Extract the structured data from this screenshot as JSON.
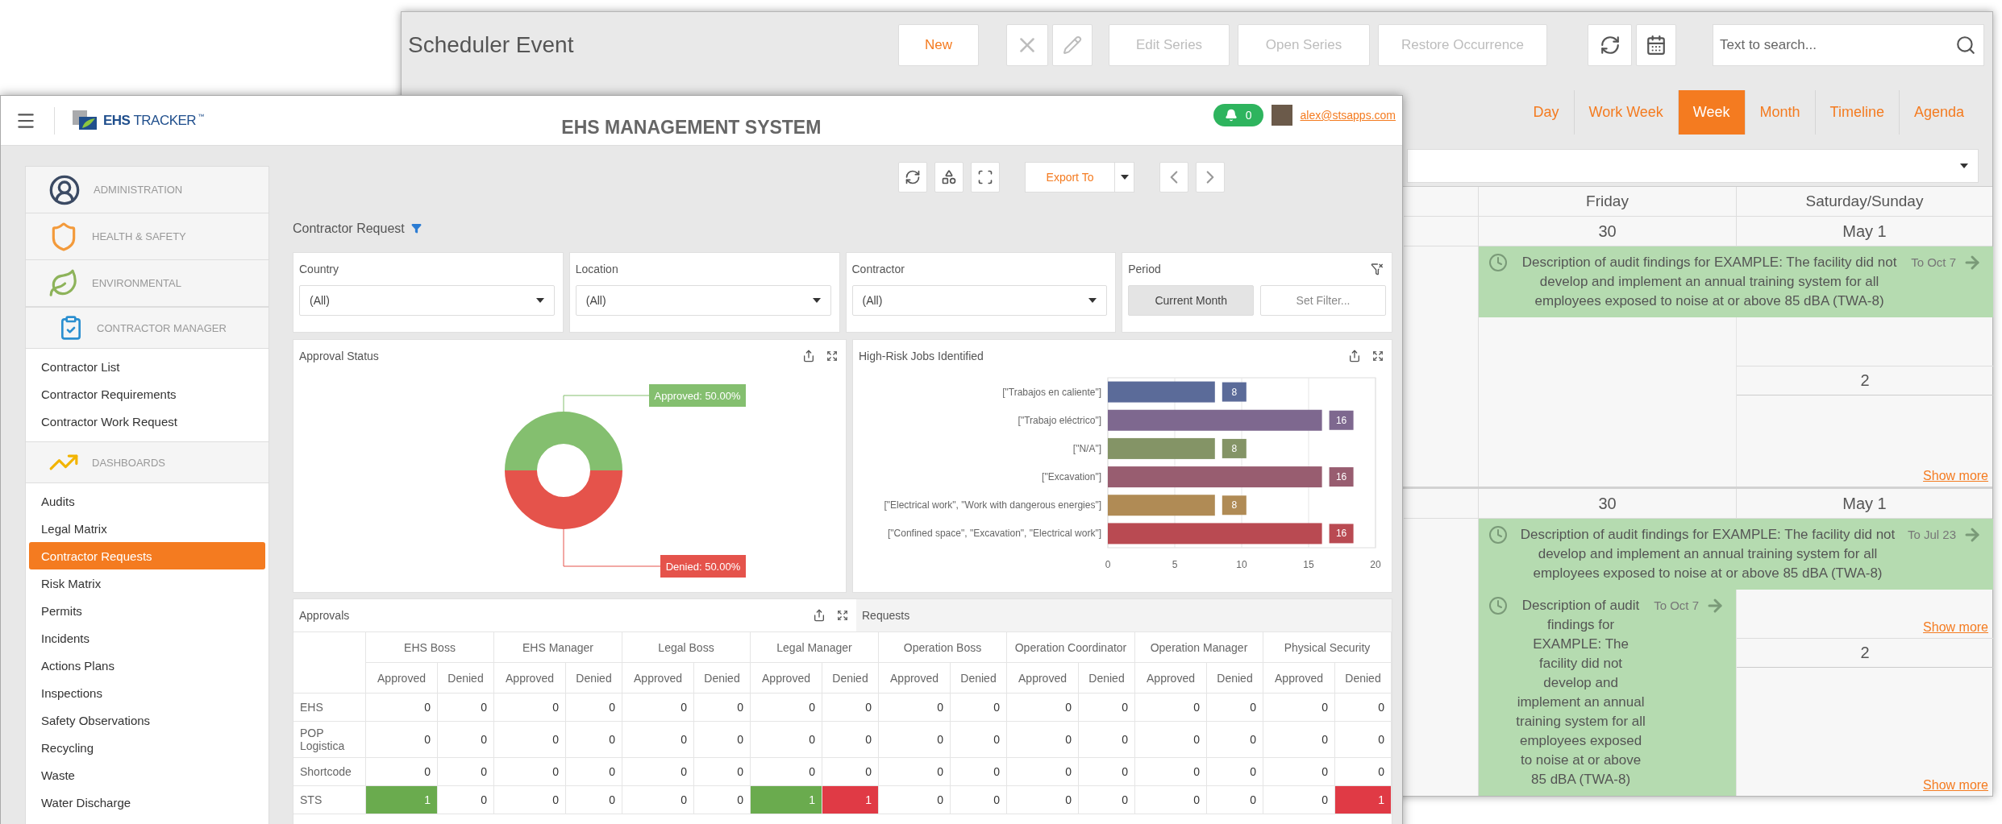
{
  "scheduler": {
    "title": "Scheduler Event",
    "new_button": "New",
    "delete_disabled": true,
    "edit_disabled": true,
    "series_buttons": [
      {
        "label": "Edit Series",
        "disabled": true
      },
      {
        "label": "Open Series",
        "disabled": true
      },
      {
        "label": "Restore Occurrence",
        "disabled": true
      }
    ],
    "search": {
      "placeholder": "Text to search..."
    },
    "views": [
      {
        "label": "Day",
        "selected": false
      },
      {
        "label": "Work Week",
        "selected": false
      },
      {
        "label": "Week",
        "selected": true
      },
      {
        "label": "Month",
        "selected": false
      },
      {
        "label": "Timeline",
        "selected": false
      },
      {
        "label": "Agenda",
        "selected": false
      }
    ],
    "calendar": {
      "columns": [
        "Friday",
        "Saturday/Sunday"
      ],
      "weeks": [
        {
          "friday": "30",
          "saturday": "May 1",
          "sunday": "2",
          "events": [
            {
              "kind": "span",
              "text": "Description of audit findings for EXAMPLE: The facility did not develop and implement an annual training system for all employees exposed to noise at or above 85 dBA (TWA-8)",
              "until": "To Oct 7"
            }
          ],
          "sunday_more": "Show more"
        },
        {
          "friday": "30",
          "saturday": "May 1",
          "sunday": "2",
          "events": [
            {
              "kind": "span",
              "text": "Description of audit findings for EXAMPLE: The facility did not develop and implement an annual training system for all employees exposed to noise at or above 85 dBA (TWA-8)",
              "until": "To Jul 23"
            },
            {
              "kind": "day",
              "text": "Description of audit findings for EXAMPLE: The facility did not develop and implement an annual training system for all employees exposed to noise at or above 85 dBA (TWA-8)",
              "until": "To Oct 7"
            }
          ],
          "saturday_more": "Show more",
          "sunday_more": "Show more"
        }
      ]
    }
  },
  "ehs": {
    "logo": "**EHS** TRACKER",
    "logo_mark": "™",
    "title": "EHS MANAGEMENT SYSTEM",
    "notifications": "0",
    "email": "alex@stsapps.com",
    "sidebar": [
      {
        "title": "ADMINISTRATION",
        "expanded": false
      },
      {
        "title": "HEALTH & SAFETY",
        "expanded": false
      },
      {
        "title": "ENVIRONMENTAL",
        "expanded": false
      },
      {
        "title": "CONTRACTOR MANAGER",
        "expanded": true,
        "items": [
          {
            "label": "Contractor List",
            "selected": false
          },
          {
            "label": "Contractor Requirements",
            "selected": false
          },
          {
            "label": "Contractor Work Request",
            "selected": false
          }
        ]
      },
      {
        "title": "DASHBOARDS",
        "expanded": true,
        "items": [
          {
            "label": "Audits",
            "selected": false
          },
          {
            "label": "Legal Matrix",
            "selected": false
          },
          {
            "label": "Contractor Requests",
            "selected": true
          },
          {
            "label": "Risk Matrix",
            "selected": false
          },
          {
            "label": "Permits",
            "selected": false
          },
          {
            "label": "Incidents",
            "selected": false
          },
          {
            "label": "Actions Plans",
            "selected": false
          },
          {
            "label": "Inspections",
            "selected": false
          },
          {
            "label": "Safety Observations",
            "selected": false
          },
          {
            "label": "Recycling",
            "selected": false
          },
          {
            "label": "Waste",
            "selected": false
          },
          {
            "label": "Water Discharge",
            "selected": false
          }
        ]
      }
    ],
    "export": "Export To",
    "page_title": "Contractor Request",
    "filters": [
      {
        "label": "Country",
        "value": "(All)"
      },
      {
        "label": "Location",
        "value": "(All)"
      },
      {
        "label": "Contractor",
        "value": "(All)"
      }
    ],
    "period": {
      "label": "Period",
      "options": [
        {
          "label": "Current Month",
          "selected": true
        },
        {
          "label": "Set Filter...",
          "selected": false
        }
      ]
    },
    "approval_status": {
      "title": "Approval Status",
      "chart_data": {
        "type": "donut",
        "values": [
          50,
          50
        ],
        "value_labels": [
          "Approved: 50.00%",
          "Denied: 50.00%"
        ]
      }
    },
    "high_risk_jobs": {
      "title": "High-Risk Jobs Identified",
      "chart_data": {
        "type": "bar",
        "orientation": "horizontal",
        "data_labels": true,
        "grid": true,
        "categories": [
          "[\"Trabajos en caliente\"]",
          "[\"Trabajo eléctrico\"]",
          "[\"N/A\"]",
          "[\"Excavation\"]",
          "[\"Electrical work\", \"Work with dangerous energies\"]",
          "[\"Confined space\", \"Excavation\", \"Electrical work\"]"
        ],
        "values": [
          8,
          16,
          8,
          16,
          8,
          16
        ],
        "xlim": [
          0,
          20
        ],
        "xticks": [
          0,
          5,
          10,
          15,
          20
        ]
      }
    },
    "approvals": {
      "tabs": [
        {
          "label": "Approvals",
          "selected": true
        },
        {
          "label": "Requests",
          "selected": false
        }
      ],
      "groups": [
        {
          "name": "EHS Boss",
          "columns": [
            "Approved",
            "Denied"
          ]
        },
        {
          "name": "EHS Manager",
          "columns": [
            "Approved",
            "Denied"
          ]
        },
        {
          "name": "Legal Boss",
          "columns": [
            "Approved",
            "Denied"
          ]
        },
        {
          "name": "Legal Manager",
          "columns": [
            "Approved",
            "Denied"
          ]
        },
        {
          "name": "Operation Boss",
          "columns": [
            "Approved",
            "Denied"
          ]
        },
        {
          "name": "Operation Coordinator",
          "columns": [
            "Approved",
            "Denied"
          ]
        },
        {
          "name": "Operation Manager",
          "columns": [
            "Approved",
            "Denied"
          ]
        },
        {
          "name": "Physical Security",
          "columns": [
            "Approved",
            "Denied"
          ]
        }
      ],
      "rows": [
        {
          "label": "EHS",
          "cells": [
            {
              "value": "0"
            },
            {
              "value": "0"
            },
            {
              "value": "0"
            },
            {
              "value": "0"
            },
            {
              "value": "0"
            },
            {
              "value": "0"
            },
            {
              "value": "0"
            },
            {
              "value": "0"
            },
            {
              "value": "0"
            },
            {
              "value": "0"
            },
            {
              "value": "0"
            },
            {
              "value": "0"
            },
            {
              "value": "0"
            },
            {
              "value": "0"
            },
            {
              "value": "0"
            },
            {
              "value": "0"
            }
          ]
        },
        {
          "label": "POP Logistica",
          "cells": [
            {
              "value": "0"
            },
            {
              "value": "0"
            },
            {
              "value": "0"
            },
            {
              "value": "0"
            },
            {
              "value": "0"
            },
            {
              "value": "0"
            },
            {
              "value": "0"
            },
            {
              "value": "0"
            },
            {
              "value": "0"
            },
            {
              "value": "0"
            },
            {
              "value": "0"
            },
            {
              "value": "0"
            },
            {
              "value": "0"
            },
            {
              "value": "0"
            },
            {
              "value": "0"
            },
            {
              "value": "0"
            }
          ]
        },
        {
          "label": "Shortcode",
          "cells": [
            {
              "value": "0"
            },
            {
              "value": "0"
            },
            {
              "value": "0"
            },
            {
              "value": "0"
            },
            {
              "value": "0"
            },
            {
              "value": "0"
            },
            {
              "value": "0"
            },
            {
              "value": "0"
            },
            {
              "value": "0"
            },
            {
              "value": "0"
            },
            {
              "value": "0"
            },
            {
              "value": "0"
            },
            {
              "value": "0"
            },
            {
              "value": "0"
            },
            {
              "value": "0"
            },
            {
              "value": "0"
            }
          ]
        },
        {
          "label": "STS",
          "cells": [
            {
              "value": "1",
              "color": "#6aab4e"
            },
            {
              "value": "0"
            },
            {
              "value": "0"
            },
            {
              "value": "0"
            },
            {
              "value": "0"
            },
            {
              "value": "0"
            },
            {
              "value": "1",
              "color": "#6aab4e"
            },
            {
              "value": "1",
              "color": "#e03a45"
            },
            {
              "value": "0"
            },
            {
              "value": "0"
            },
            {
              "value": "0"
            },
            {
              "value": "0"
            },
            {
              "value": "0"
            },
            {
              "value": "0"
            },
            {
              "value": "0"
            },
            {
              "value": "1",
              "color": "#e03a45"
            }
          ]
        }
      ]
    }
  }
}
